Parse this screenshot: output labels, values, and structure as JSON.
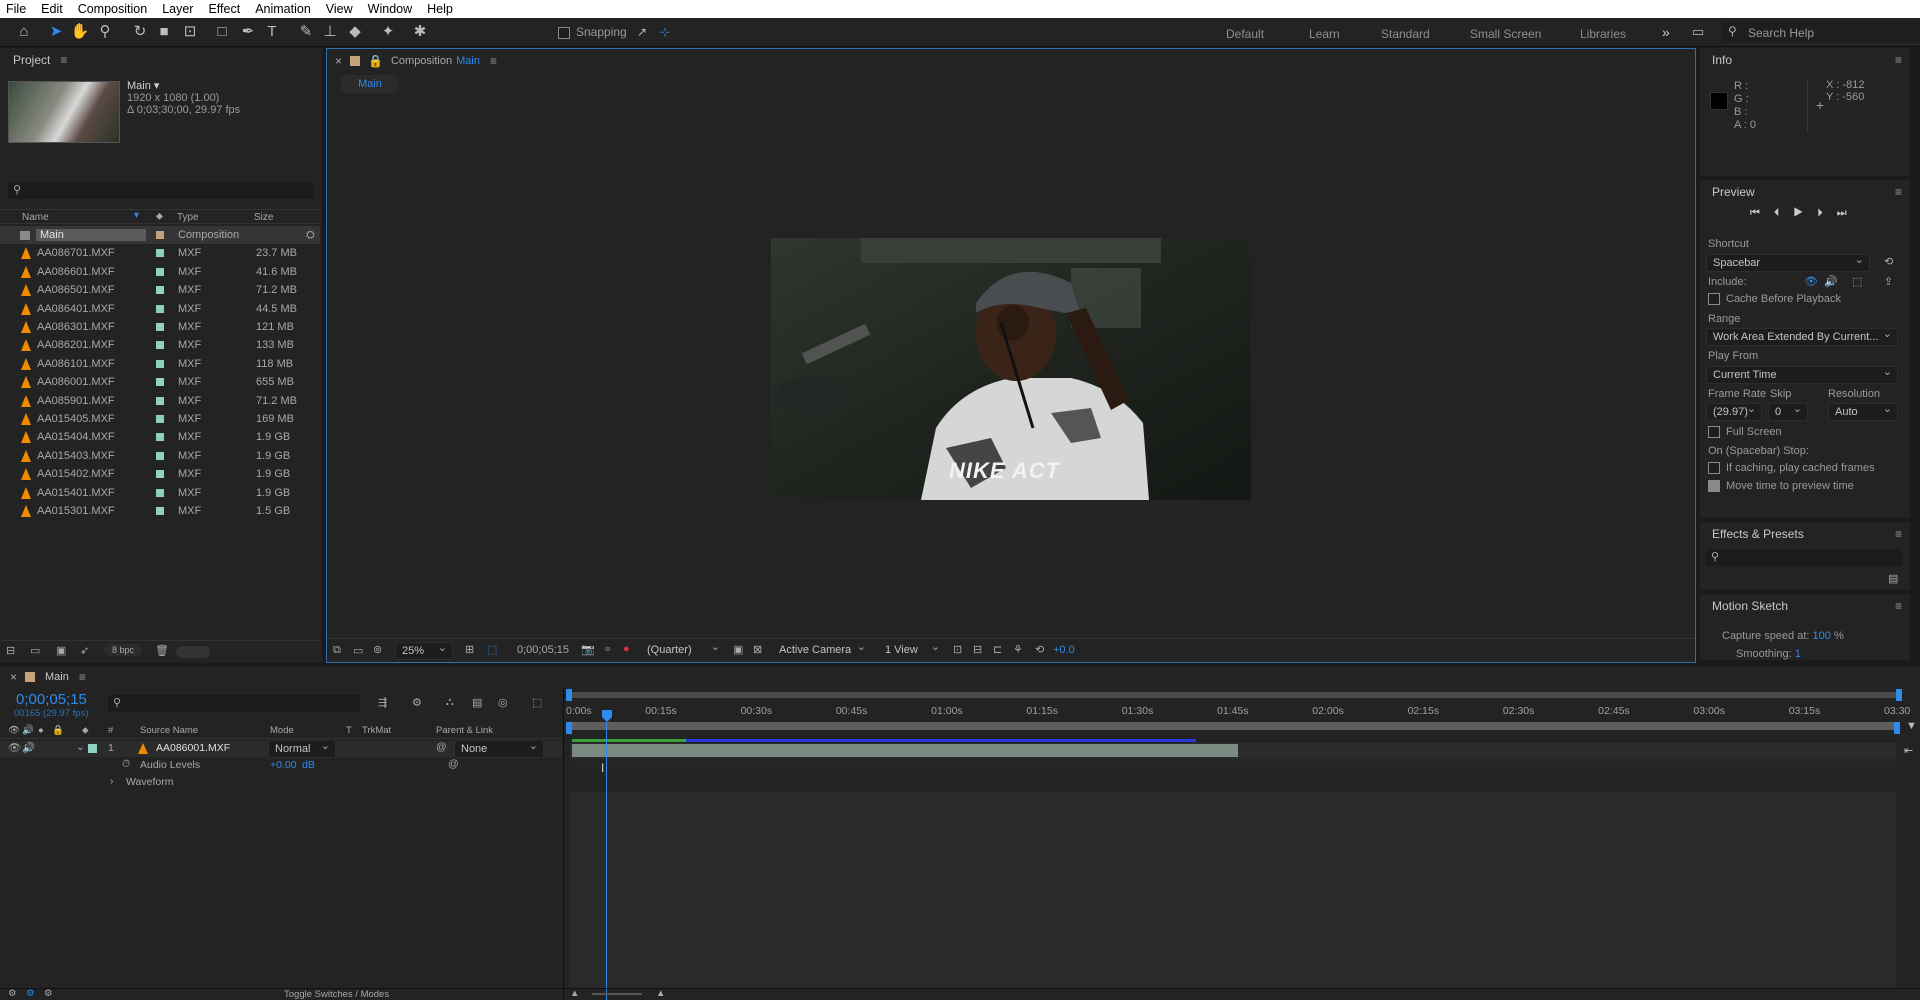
{
  "menu": [
    "File",
    "Edit",
    "Composition",
    "Layer",
    "Effect",
    "Animation",
    "View",
    "Window",
    "Help"
  ],
  "toolbar": {
    "snapping": "Snapping",
    "workspaces": [
      "Default",
      "Learn",
      "Standard",
      "Small Screen",
      "Libraries"
    ],
    "search_help": "Search Help"
  },
  "project": {
    "title": "Project",
    "comp_name": "Main",
    "comp_info1": "1920 x 1080 (1.00)",
    "comp_info2": "Δ 0;03;30;00, 29.97 fps",
    "columns": {
      "name": "Name",
      "type": "Type",
      "size": "Size"
    },
    "items": [
      {
        "name": "Main",
        "type": "Composition",
        "size": ""
      },
      {
        "name": "AA086701.MXF",
        "type": "MXF",
        "size": "23.7 MB"
      },
      {
        "name": "AA086601.MXF",
        "type": "MXF",
        "size": "41.6 MB"
      },
      {
        "name": "AA086501.MXF",
        "type": "MXF",
        "size": "71.2 MB"
      },
      {
        "name": "AA086401.MXF",
        "type": "MXF",
        "size": "44.5 MB"
      },
      {
        "name": "AA086301.MXF",
        "type": "MXF",
        "size": "121 MB"
      },
      {
        "name": "AA086201.MXF",
        "type": "MXF",
        "size": "133 MB"
      },
      {
        "name": "AA086101.MXF",
        "type": "MXF",
        "size": "118 MB"
      },
      {
        "name": "AA086001.MXF",
        "type": "MXF",
        "size": "655 MB"
      },
      {
        "name": "AA085901.MXF",
        "type": "MXF",
        "size": "71.2 MB"
      },
      {
        "name": "AA015405.MXF",
        "type": "MXF",
        "size": "169 MB"
      },
      {
        "name": "AA015404.MXF",
        "type": "MXF",
        "size": "1.9 GB"
      },
      {
        "name": "AA015403.MXF",
        "type": "MXF",
        "size": "1.9 GB"
      },
      {
        "name": "AA015402.MXF",
        "type": "MXF",
        "size": "1.9 GB"
      },
      {
        "name": "AA015401.MXF",
        "type": "MXF",
        "size": "1.9 GB"
      },
      {
        "name": "AA015301.MXF",
        "type": "MXF",
        "size": "1.5 GB"
      }
    ],
    "bpc": "8 bpc"
  },
  "composition": {
    "tab_prefix": "Composition",
    "tab_name": "Main",
    "subtab": "Main",
    "zoom": "25%",
    "timecode": "0;00;05;15",
    "resolution": "(Quarter)",
    "camera": "Active Camera",
    "views": "1 View",
    "exposure": "+0.0",
    "frame_text": "NIKE ACT"
  },
  "info": {
    "title": "Info",
    "r": "R :",
    "g": "G :",
    "b": "B :",
    "a": "A : 0",
    "x": "X : -812",
    "y": "Y : -560"
  },
  "preview": {
    "title": "Preview",
    "shortcut_label": "Shortcut",
    "shortcut": "Spacebar",
    "include": "Include:",
    "cache": "Cache Before Playback",
    "range_label": "Range",
    "range": "Work Area Extended By Current...",
    "play_from_label": "Play From",
    "play_from": "Current Time",
    "frame_rate_label": "Frame Rate",
    "skip_label": "Skip",
    "resolution_label": "Resolution",
    "frame_rate": "(29.97)",
    "skip": "0",
    "resolution": "Auto",
    "full_screen": "Full Screen",
    "stop_label": "On (Spacebar) Stop:",
    "if_caching": "If caching, play cached frames",
    "move_time": "Move time to preview time"
  },
  "effects": {
    "title": "Effects & Presets"
  },
  "motion": {
    "title": "Motion Sketch",
    "capture_label": "Capture speed at:",
    "capture_value": "100",
    "capture_unit": "%",
    "smoothing_label": "Smoothing:",
    "smoothing_value": "1"
  },
  "timeline": {
    "tab": "Main",
    "timecode": "0;00;05;15",
    "frames": "00165 (29.97 fps)",
    "columns": {
      "num": "#",
      "source": "Source Name",
      "mode": "Mode",
      "t": "T",
      "trkmat": "TrkMat",
      "parent": "Parent & Link"
    },
    "layer": {
      "num": "1",
      "name": "AA086001.MXF",
      "mode": "Normal",
      "parent": "None"
    },
    "audio_levels": "Audio Levels",
    "audio_value": "+0.00",
    "audio_unit": "dB",
    "waveform": "Waveform",
    "toggle": "Toggle Switches / Modes",
    "ruler": [
      "0:00s",
      "00:15s",
      "00:30s",
      "00:45s",
      "01:00s",
      "01:15s",
      "01:30s",
      "01:45s",
      "02:00s",
      "02:15s",
      "02:30s",
      "02:45s",
      "03:00s",
      "03:15s",
      "03:30"
    ]
  },
  "colors": {
    "accent": "#2d8ceb",
    "label": "#8fd1c0",
    "cone": "#f08a00"
  }
}
